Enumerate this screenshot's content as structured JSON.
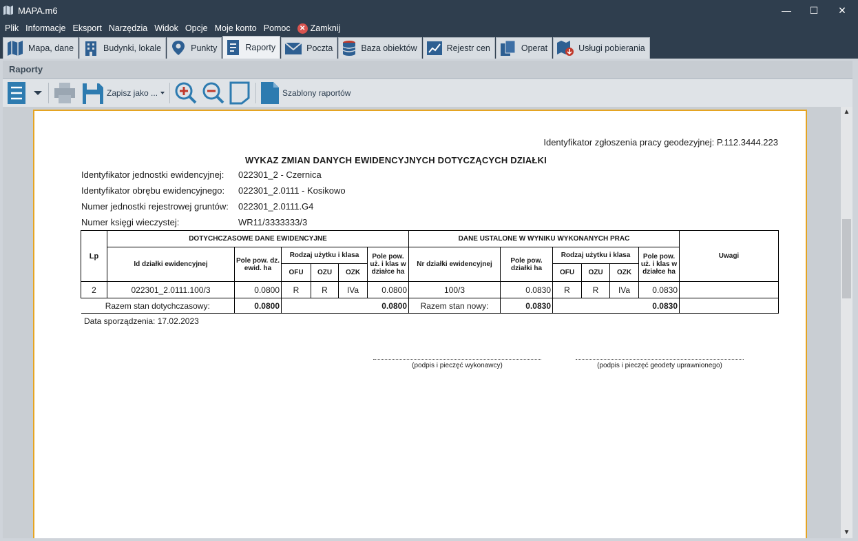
{
  "window": {
    "title": "MAPA.m6",
    "minimize": "—",
    "maximize": "☐",
    "close": "✕"
  },
  "menu": {
    "items": [
      "Plik",
      "Informacje",
      "Eksport",
      "Narzędzia",
      "Widok",
      "Opcje",
      "Moje konto",
      "Pomoc"
    ],
    "close_label": "Zamknij"
  },
  "tabs": [
    {
      "label": "Mapa, dane",
      "icon": "map-icon"
    },
    {
      "label": "Budynki, lokale",
      "icon": "building-icon"
    },
    {
      "label": "Punkty",
      "icon": "pin-icon"
    },
    {
      "label": "Raporty",
      "icon": "report-icon",
      "active": true
    },
    {
      "label": "Poczta",
      "icon": "mail-icon"
    },
    {
      "label": "Baza obiektów",
      "icon": "database-icon"
    },
    {
      "label": "Rejestr cen",
      "icon": "chart-icon"
    },
    {
      "label": "Operat",
      "icon": "documents-icon"
    },
    {
      "label": "Usługi pobierania",
      "icon": "download-map-icon"
    }
  ],
  "section": {
    "title": "Raporty"
  },
  "toolbar": {
    "save_as_label": "Zapisz jako ...",
    "templates_label": "Szablony raportów"
  },
  "report": {
    "identifier_line": "Identyfikator zgłoszenia pracy geodezyjnej: P.112.3444.223",
    "heading": "WYKAZ ZMIAN DANYCH EWIDENCYJNYCH DOTYCZĄCYCH DZIAŁKI",
    "info": [
      {
        "label": "Identyfikator jednostki ewidencyjnej:",
        "value": "022301_2 - Czernica"
      },
      {
        "label": "Identyfikator obrębu ewidencyjnego:",
        "value": "022301_2.0111 - Kosikowo"
      },
      {
        "label": "Numer jednostki rejestrowej gruntów:",
        "value": "022301_2.0111.G4"
      },
      {
        "label": "Numer księgi wieczystej:",
        "value": "WR11/3333333/3"
      }
    ],
    "table": {
      "col_lp": "Lp",
      "group_old": "DOTYCHCZASOWE DANE EWIDENCYJNE",
      "group_new": "DANE USTALONE W WYNIKU WYKONANYCH PRAC",
      "col_uwagi": "Uwagi",
      "old_id": "Id działki ewidencyjnej",
      "old_area": "Pole pow. dz. ewid. ha",
      "old_use": "Rodzaj użytku i klasa",
      "old_use_area": "Pole pow. uż. i klas w działce ha",
      "new_id": "Nr działki ewidencyjnej",
      "new_area": "Pole pow. działki ha",
      "new_use": "Rodzaj użytku i klasa",
      "new_use_area": "Pole pow. uż. i klas w działce ha",
      "ofu": "OFU",
      "ozu": "OZU",
      "ozk": "OZK",
      "row": {
        "lp": "2",
        "old_id": "022301_2.0111.100/3",
        "old_area": "0.0800",
        "old_ofu": "R",
        "old_ozu": "R",
        "old_ozk": "IVa",
        "old_use_area": "0.0800",
        "new_id": "100/3",
        "new_area": "0.0830",
        "new_ofu": "R",
        "new_ozu": "R",
        "new_ozk": "IVa",
        "new_use_area": "0.0830"
      },
      "sum_old_label": "Razem stan dotychczasowy:",
      "sum_old_area": "0.0800",
      "sum_old_use": "0.0800",
      "sum_new_label": "Razem stan nowy:",
      "sum_new_area": "0.0830",
      "sum_new_use": "0.0830"
    },
    "date_line": "Data sporządzenia: 17.02.2023",
    "sig_contractor": "(podpis i pieczęć wykonawcy)",
    "sig_surveyor": "(podpis i pieczęć geodety uprawnionego)"
  }
}
